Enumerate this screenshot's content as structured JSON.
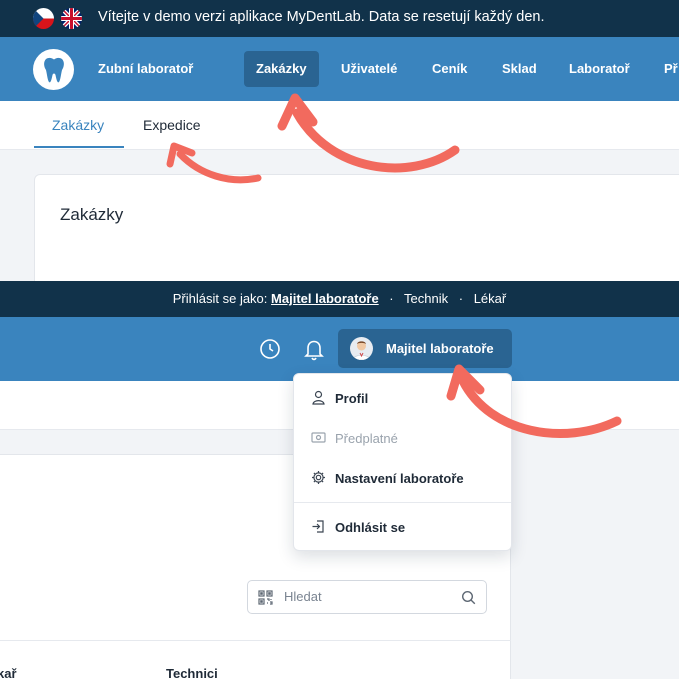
{
  "banner": {
    "text": "Vítejte v demo verzi aplikace MyDentLab. Data se resetují každý den.",
    "flags": [
      "czech-flag-icon",
      "uk-flag-icon"
    ]
  },
  "nav": {
    "brand": "Zubní laboratoř",
    "items": [
      {
        "label": "Zakázky",
        "active": true
      },
      {
        "label": "Uživatelé",
        "active": false
      },
      {
        "label": "Ceník",
        "active": false
      },
      {
        "label": "Sklad",
        "active": false
      },
      {
        "label": "Laboratoř",
        "active": false
      },
      {
        "label": "Př",
        "active": false
      }
    ]
  },
  "subtabs": [
    {
      "label": "Zakázky",
      "active": true
    },
    {
      "label": "Expedice",
      "active": false
    }
  ],
  "card": {
    "title": "Zakázky"
  },
  "login_as": {
    "prefix": "Přihlásit se jako:",
    "roles": [
      "Majitel laboratoře",
      "Technik",
      "Lékař"
    ],
    "separator": "·"
  },
  "user_menu": {
    "name": "Majitel laboratoře",
    "items": [
      {
        "label": "Profil",
        "icon": "user-icon",
        "disabled": false
      },
      {
        "label": "Předplatné",
        "icon": "card-icon",
        "disabled": true
      },
      {
        "label": "Nastavení laboratoře",
        "icon": "gear-icon",
        "disabled": false
      },
      {
        "label": "Odhlásit se",
        "icon": "logout-icon",
        "disabled": false
      }
    ]
  },
  "search": {
    "placeholder": "Hledat"
  },
  "table": {
    "headers": [
      "kař",
      "Technici"
    ]
  },
  "colors": {
    "banner_bg": "#11324a",
    "nav_bg": "#3a84be",
    "nav_active": "#2a6492",
    "arrow": "#f26a5e"
  }
}
